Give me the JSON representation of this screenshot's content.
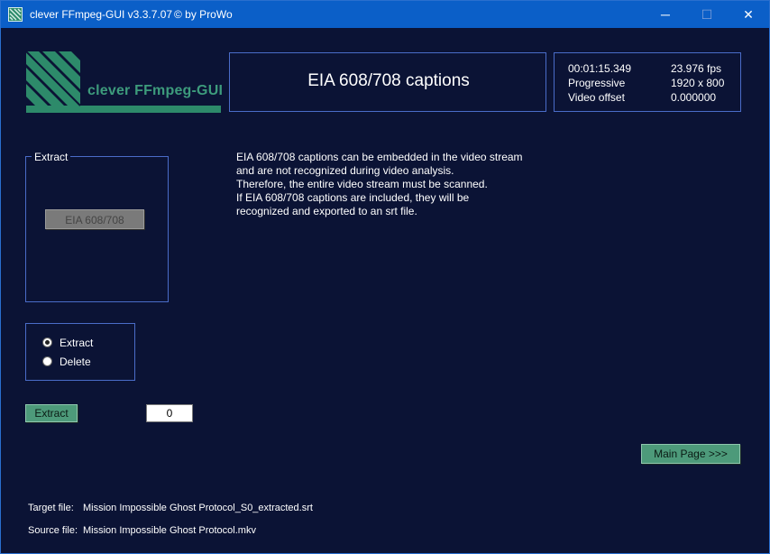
{
  "window": {
    "title": "clever FFmpeg-GUI v3.3.7.07",
    "credit": "© by ProWo",
    "controls": {
      "minimize": "─",
      "maximize": "☐",
      "close": "✕"
    }
  },
  "logo": {
    "text": "clever FFmpeg-GUI",
    "icon": "ffmpeg-logo-icon"
  },
  "header": {
    "title": "EIA 608/708 captions"
  },
  "info": {
    "duration": "00:01:15.349",
    "fps": "23.976 fps",
    "scan": "Progressive",
    "resolution": "1920 x 800",
    "offset_label": "Video offset",
    "offset_value": "0.000000"
  },
  "extract_group": {
    "legend": "Extract",
    "button_label": "EIA 608/708"
  },
  "description": [
    "EIA 608/708 captions can be embedded in the video stream",
    "and are not recognized during video analysis.",
    "Therefore, the entire video stream must be scanned.",
    "If EIA 608/708 captions are included, they will be",
    "recognized and exported to an srt file."
  ],
  "mode": {
    "options": [
      {
        "label": "Extract",
        "selected": true
      },
      {
        "label": "Delete",
        "selected": false
      }
    ]
  },
  "actions": {
    "extract_label": "Extract",
    "count_value": "0",
    "main_page_label": "Main Page >>>"
  },
  "files": {
    "target_label": "Target file:",
    "target_value": "Mission Impossible Ghost Protocol_S0_extracted.srt",
    "source_label": "Source file:",
    "source_value": "Mission Impossible Ghost Protocol.mkv"
  },
  "colors": {
    "background": "#0b1335",
    "titlebar": "#0b5fc8",
    "accent_green": "#4d9a7a",
    "border_blue": "#4a6cc8"
  }
}
